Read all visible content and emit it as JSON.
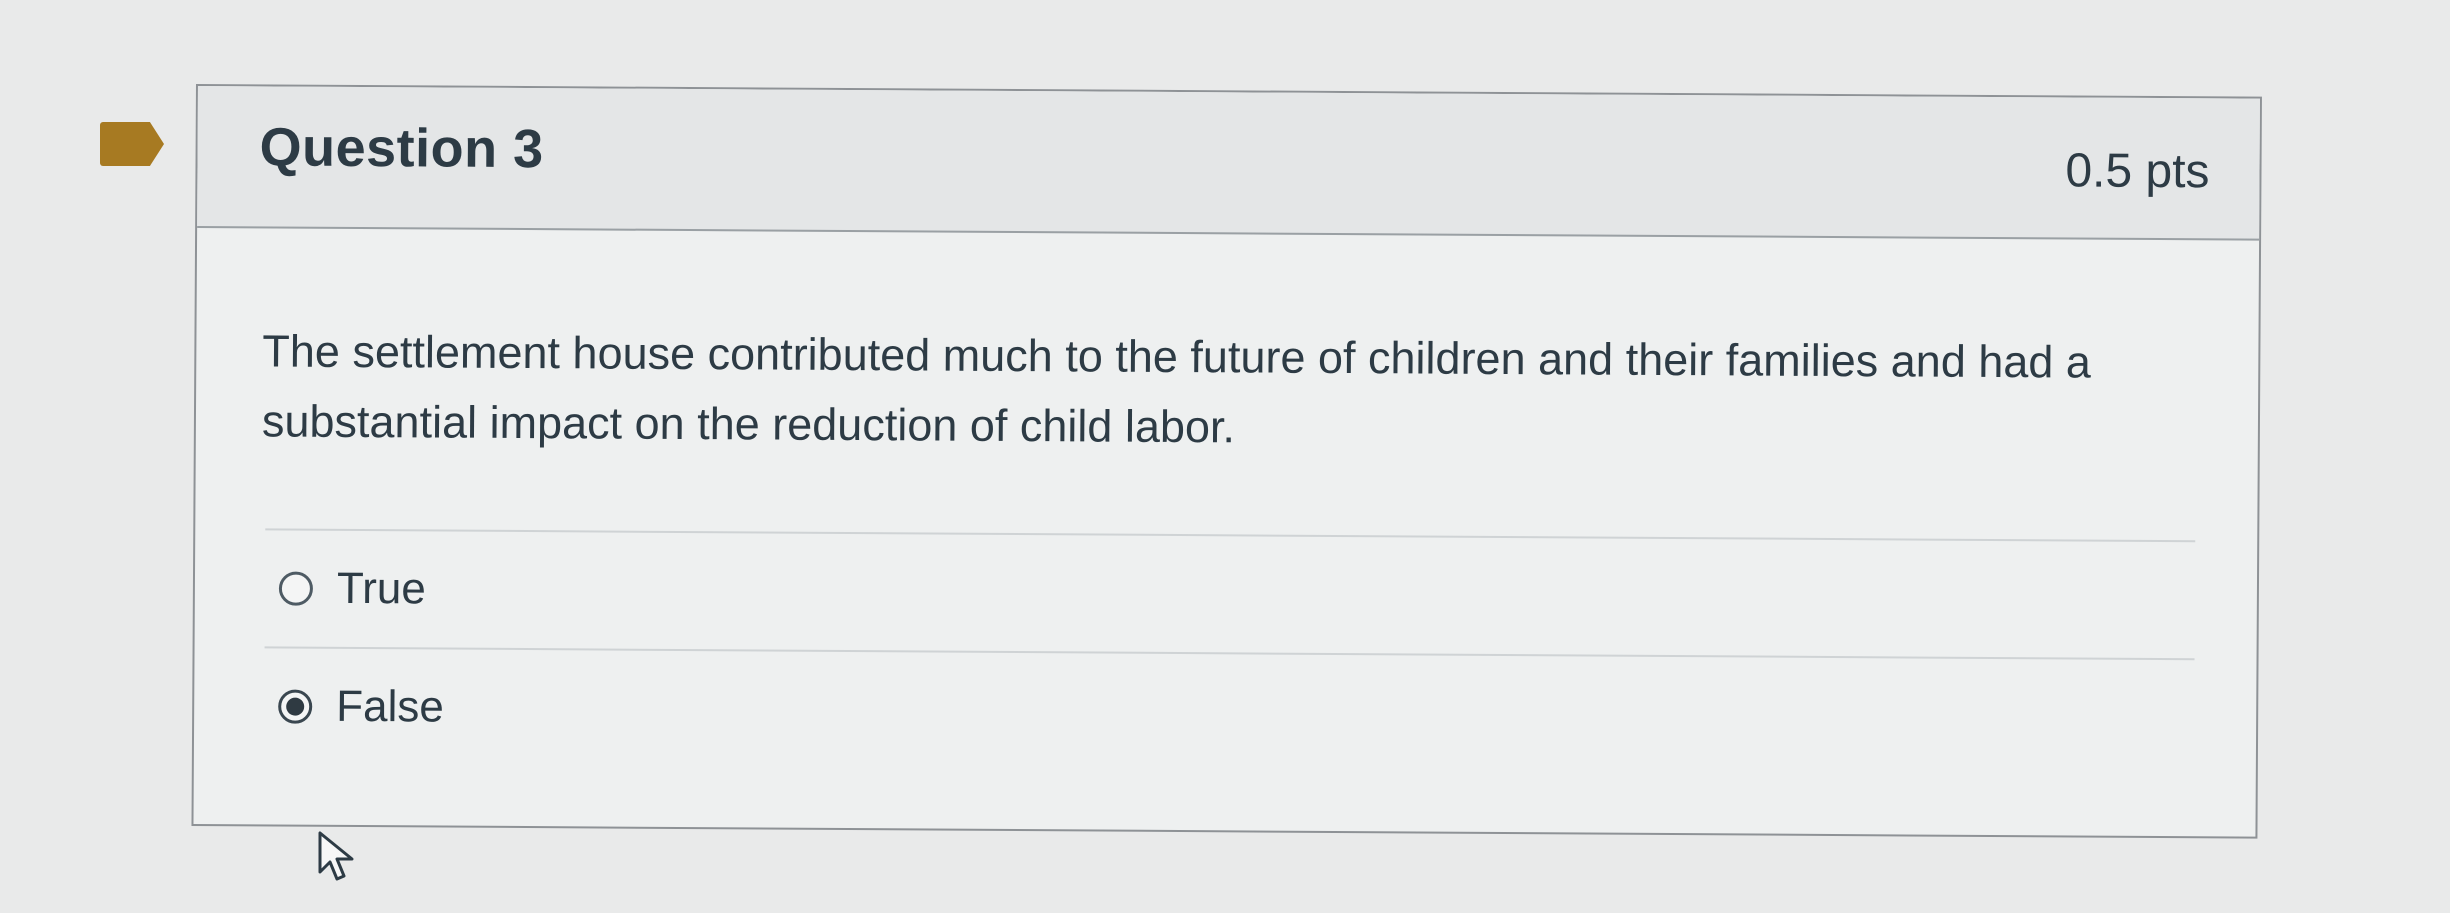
{
  "question": {
    "title": "Question 3",
    "points": "0.5 pts",
    "text": "The settlement house contributed much to the future of children and their families and had a substantial impact on the reduction of child labor.",
    "answers": [
      {
        "label": "True",
        "selected": false
      },
      {
        "label": "False",
        "selected": true
      }
    ]
  },
  "colors": {
    "flag": "#a77a22",
    "text": "#2d3b45",
    "page_background": "#e9eaea"
  },
  "icons": {
    "flag": "flag-icon",
    "cursor": "mouse-pointer-icon"
  }
}
